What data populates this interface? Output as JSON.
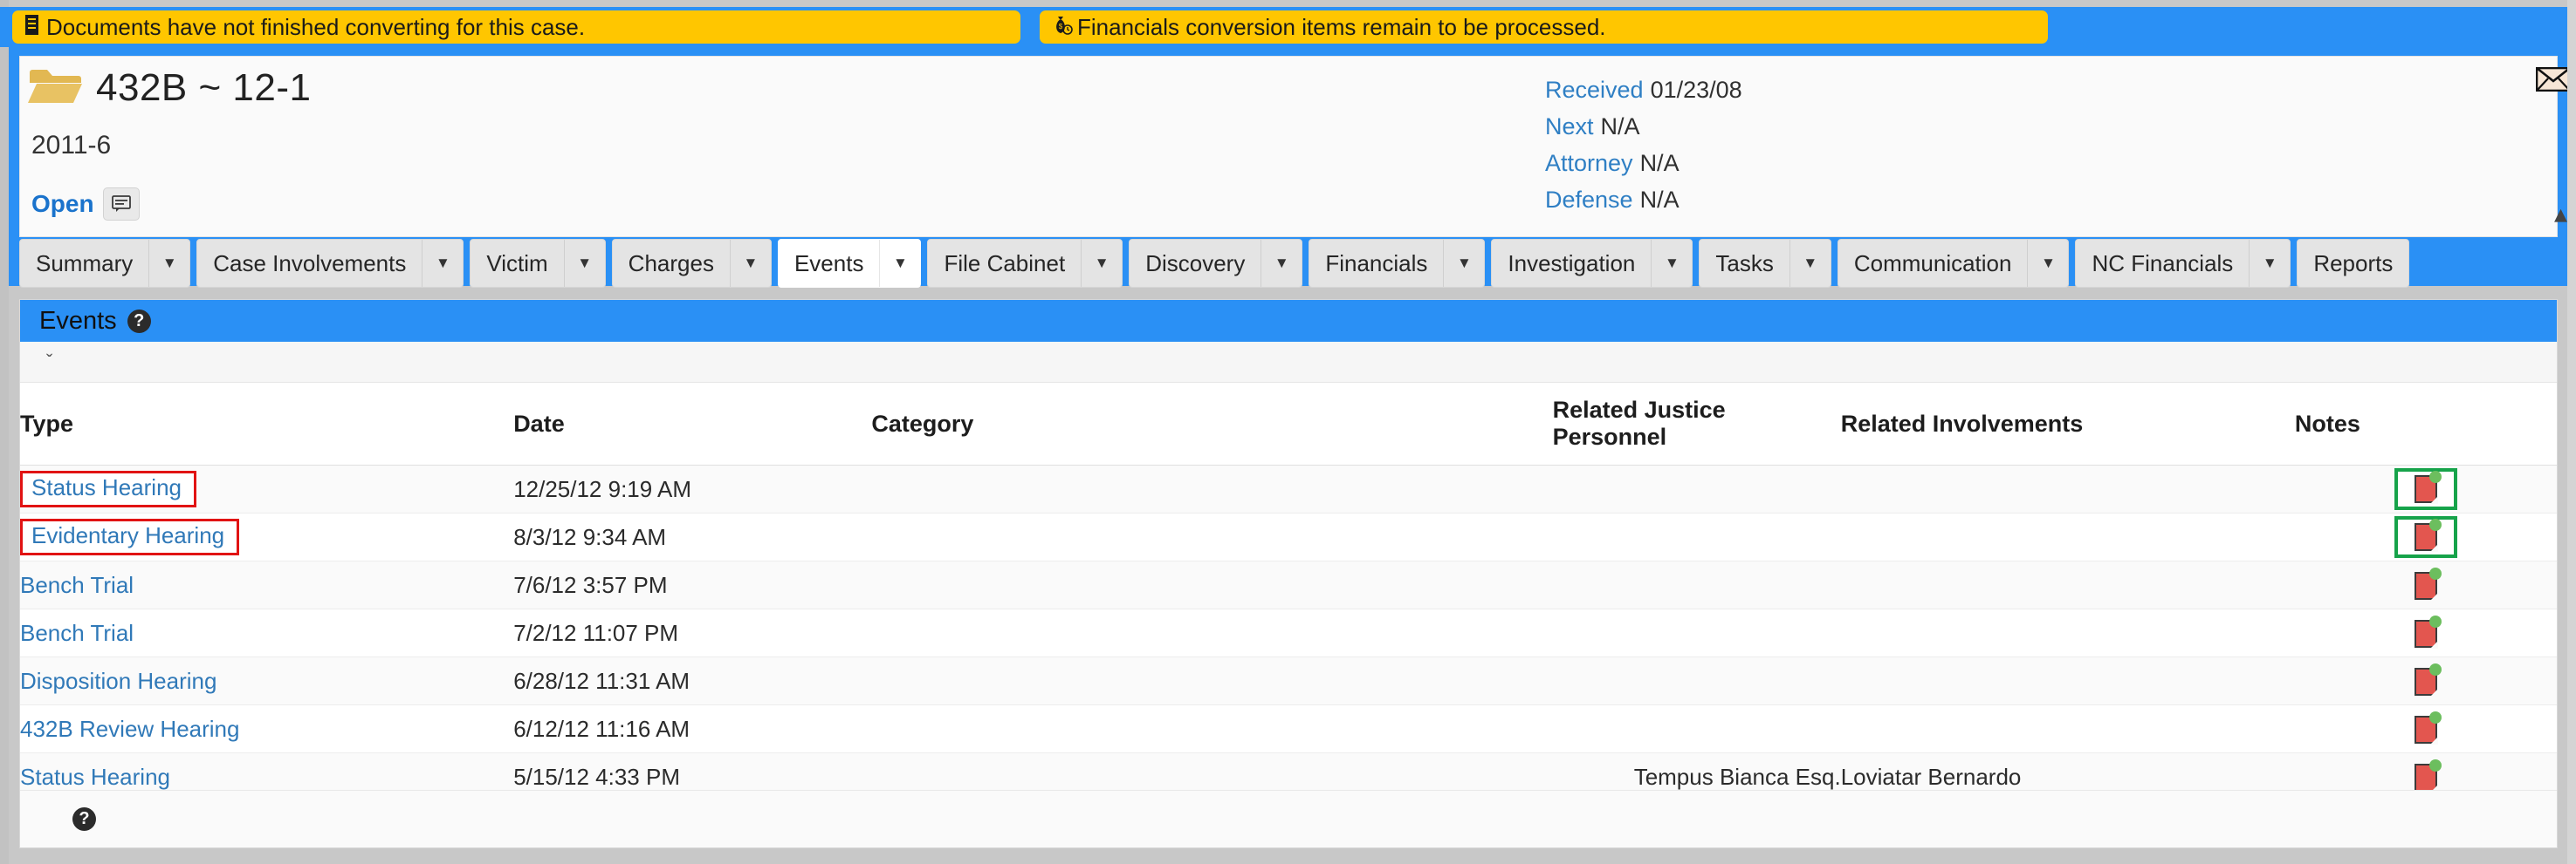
{
  "alerts": [
    {
      "icon": "document-icon",
      "glyph": "὜E",
      "text": "Documents have not finished converting for this case."
    },
    {
      "icon": "money-bag-icon",
      "glyph": "Ὃ0",
      "text": "Financials conversion items remain to be processed."
    }
  ],
  "case_header": {
    "folder_icon": "folder-icon",
    "title": "432B ~ 12-1",
    "case_number": "2011-6",
    "status": "Open",
    "comment_icon": "comment-icon",
    "envelope_icon": "envelope-icon",
    "expand_caret": "▴",
    "meta": [
      {
        "label": "Received",
        "value": "01/23/08"
      },
      {
        "label": "Next",
        "value": "N/A"
      },
      {
        "label": "Attorney",
        "value": "N/A"
      },
      {
        "label": "Defense",
        "value": "N/A"
      }
    ]
  },
  "tabs": [
    {
      "label": "Summary",
      "has_caret": true,
      "active": false
    },
    {
      "label": "Case Involvements",
      "has_caret": true,
      "active": false
    },
    {
      "label": "Victim",
      "has_caret": true,
      "active": false
    },
    {
      "label": "Charges",
      "has_caret": true,
      "active": false
    },
    {
      "label": "Events",
      "has_caret": true,
      "active": true
    },
    {
      "label": "File Cabinet",
      "has_caret": true,
      "active": false
    },
    {
      "label": "Discovery",
      "has_caret": true,
      "active": false
    },
    {
      "label": "Financials",
      "has_caret": true,
      "active": false
    },
    {
      "label": "Investigation",
      "has_caret": true,
      "active": false
    },
    {
      "label": "Tasks",
      "has_caret": true,
      "active": false
    },
    {
      "label": "Communication",
      "has_caret": true,
      "active": false
    },
    {
      "label": "NC Financials",
      "has_caret": true,
      "active": false
    },
    {
      "label": "Reports",
      "has_caret": false,
      "active": false
    }
  ],
  "panel": {
    "title": "Events",
    "help_glyph": "?",
    "collapse_glyph": "ˇ",
    "footer_help_glyph": "?"
  },
  "table": {
    "columns": [
      "Type",
      "Date",
      "Category",
      "Related Justice Personnel",
      "Related Involvements",
      "Notes"
    ],
    "sorted_column": "Date",
    "rows": [
      {
        "type": "Status Hearing",
        "date": "12/25/12 9:19 AM",
        "category": "",
        "justice_personnel": "",
        "involvements": "",
        "note_icon": "note-icon",
        "type_highlight": "red",
        "note_highlight": "green"
      },
      {
        "type": "Evidentary Hearing",
        "date": "8/3/12 9:34 AM",
        "category": "",
        "justice_personnel": "",
        "involvements": "",
        "note_icon": "note-icon",
        "type_highlight": "red",
        "note_highlight": "green"
      },
      {
        "type": "Bench Trial",
        "date": "7/6/12 3:57 PM",
        "category": "",
        "justice_personnel": "",
        "involvements": "",
        "note_icon": "note-icon",
        "type_highlight": "",
        "note_highlight": ""
      },
      {
        "type": "Bench Trial",
        "date": "7/2/12 11:07 PM",
        "category": "",
        "justice_personnel": "",
        "involvements": "",
        "note_icon": "note-icon",
        "type_highlight": "",
        "note_highlight": ""
      },
      {
        "type": "Disposition Hearing",
        "date": "6/28/12 11:31 AM",
        "category": "",
        "justice_personnel": "",
        "involvements": "",
        "note_icon": "note-icon",
        "type_highlight": "",
        "note_highlight": ""
      },
      {
        "type": "432B Review Hearing",
        "date": "6/12/12 11:16 AM",
        "category": "",
        "justice_personnel": "",
        "involvements": "",
        "note_icon": "note-icon",
        "type_highlight": "",
        "note_highlight": ""
      },
      {
        "type": "Status Hearing",
        "date": "5/15/12 4:33 PM",
        "category": "",
        "justice_personnel": "Tempus Bianca Esq.",
        "involvements": "Loviatar Bernardo",
        "note_icon": "note-icon",
        "type_highlight": "",
        "note_highlight": ""
      }
    ]
  },
  "colors": {
    "banner_blue": "#2a90f5",
    "alert_yellow": "#ffc600",
    "link_blue": "#3079b8",
    "annotation_red": "#e11313",
    "annotation_green": "#16a34a",
    "sorted_col_bg": "#d9ebf5"
  }
}
